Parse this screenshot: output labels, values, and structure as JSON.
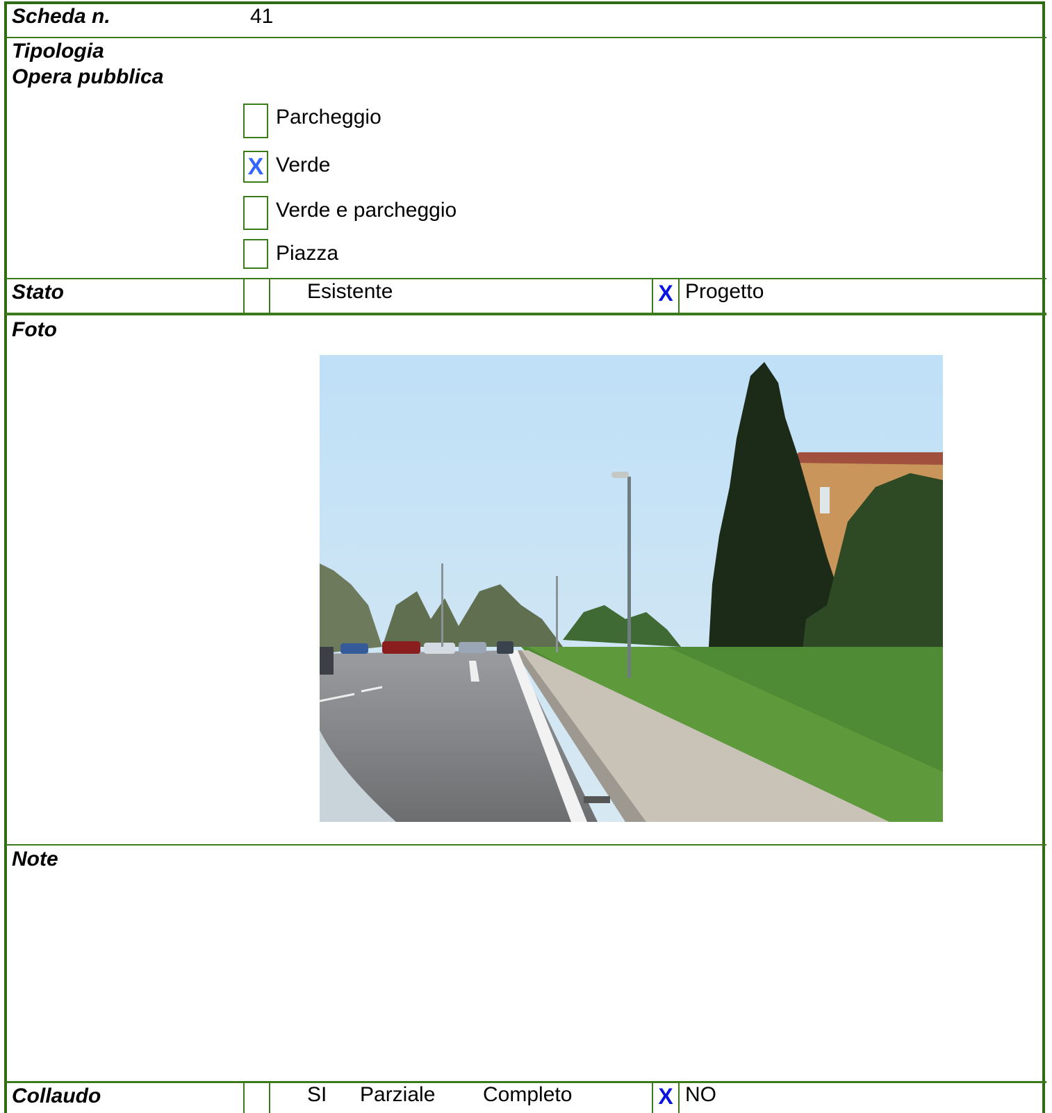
{
  "scheda": {
    "label": "Scheda n.",
    "value": "41"
  },
  "tipologia": {
    "label_line1": "Tipologia",
    "label_line2": "Opera pubblica",
    "options": [
      {
        "label": "Parcheggio",
        "checked": false,
        "mark": ""
      },
      {
        "label": "Verde",
        "checked": true,
        "mark": "X"
      },
      {
        "label": "Verde e parcheggio",
        "checked": false,
        "mark": ""
      },
      {
        "label": "Piazza",
        "checked": false,
        "mark": ""
      }
    ]
  },
  "stato": {
    "label": "Stato",
    "esistente": {
      "label": "Esistente",
      "mark": ""
    },
    "progetto": {
      "label": "Progetto",
      "mark": "X"
    }
  },
  "foto": {
    "label": "Foto",
    "image": "photo of a road with sidewalk, grass verge, street lamps, cypress tree and house"
  },
  "note": {
    "label": "Note",
    "text": ""
  },
  "collaudo": {
    "label": "Collaudo",
    "si": "SI",
    "parziale": "Parziale",
    "completo": "Completo",
    "no": {
      "label": "NO",
      "mark": "X"
    }
  },
  "colors": {
    "border": "#3a7a1a",
    "check_mark": "#3366ff",
    "mark_dark": "#0a14e0"
  }
}
